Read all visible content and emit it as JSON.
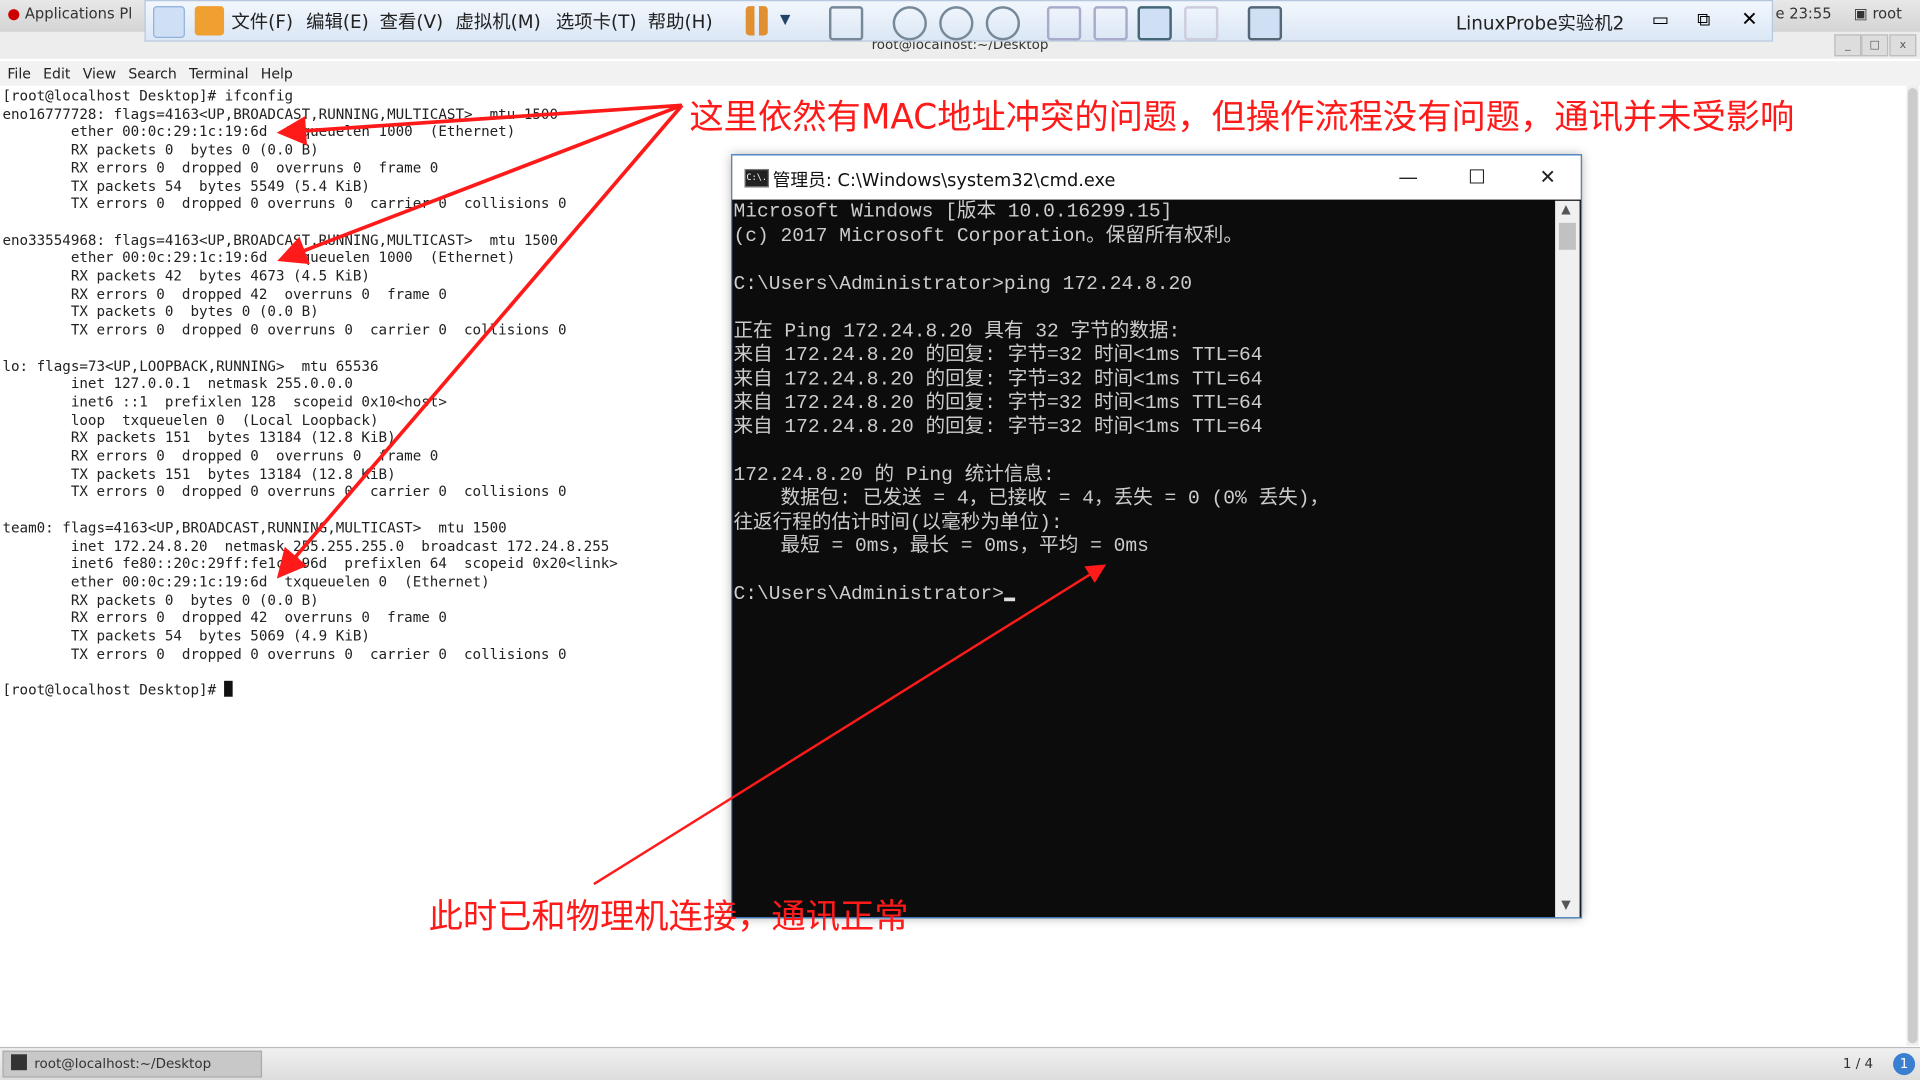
{
  "gnome_top": {
    "applications": "Applications",
    "places_partial": "Pl",
    "clock": "e 23:55",
    "user": "root"
  },
  "terminal_window": {
    "title": "root@localhost:~/Desktop",
    "menu": [
      "File",
      "Edit",
      "View",
      "Search",
      "Terminal",
      "Help"
    ],
    "lines": [
      "[root@localhost Desktop]# ifconfig",
      "eno16777728: flags=4163<UP,BROADCAST,RUNNING,MULTICAST>  mtu 1500",
      "        ether 00:0c:29:1c:19:6d  txqueuelen 1000  (Ethernet)",
      "        RX packets 0  bytes 0 (0.0 B)",
      "        RX errors 0  dropped 0  overruns 0  frame 0",
      "        TX packets 54  bytes 5549 (5.4 KiB)",
      "        TX errors 0  dropped 0 overruns 0  carrier 0  collisions 0",
      "",
      "eno33554968: flags=4163<UP,BROADCAST,RUNNING,MULTICAST>  mtu 1500",
      "        ether 00:0c:29:1c:19:6d  txqueuelen 1000  (Ethernet)",
      "        RX packets 42  bytes 4673 (4.5 KiB)",
      "        RX errors 0  dropped 42  overruns 0  frame 0",
      "        TX packets 0  bytes 0 (0.0 B)",
      "        TX errors 0  dropped 0 overruns 0  carrier 0  collisions 0",
      "",
      "lo: flags=73<UP,LOOPBACK,RUNNING>  mtu 65536",
      "        inet 127.0.0.1  netmask 255.0.0.0",
      "        inet6 ::1  prefixlen 128  scopeid 0x10<host>",
      "        loop  txqueuelen 0  (Local Loopback)",
      "        RX packets 151  bytes 13184 (12.8 KiB)",
      "        RX errors 0  dropped 0  overruns 0  frame 0",
      "        TX packets 151  bytes 13184 (12.8 KiB)",
      "        TX errors 0  dropped 0 overruns 0  carrier 0  collisions 0",
      "",
      "team0: flags=4163<UP,BROADCAST,RUNNING,MULTICAST>  mtu 1500",
      "        inet 172.24.8.20  netmask 255.255.255.0  broadcast 172.24.8.255",
      "        inet6 fe80::20c:29ff:fe1c:196d  prefixlen 64  scopeid 0x20<link>",
      "        ether 00:0c:29:1c:19:6d  txqueuelen 0  (Ethernet)",
      "        RX packets 0  bytes 0 (0.0 B)",
      "        RX errors 0  dropped 42  overruns 0  frame 0",
      "        TX packets 54  bytes 5069 (4.9 KiB)",
      "        TX errors 0  dropped 0 overruns 0  carrier 0  collisions 0",
      ""
    ],
    "prompt": "[root@localhost Desktop]# "
  },
  "vmware_bar": {
    "menus": [
      "文件(F)",
      "编辑(E)",
      "查看(V)",
      "虚拟机(M)",
      "选项卡(T)",
      "帮助(H)"
    ],
    "vm_name": "LinuxProbe实验机2"
  },
  "cmd_window": {
    "title": "管理员: C:\\Windows\\system32\\cmd.exe",
    "icon_text": "C:\\.",
    "lines": [
      "Microsoft Windows [版本 10.0.16299.15]",
      "(c) 2017 Microsoft Corporation。保留所有权利。",
      "",
      "C:\\Users\\Administrator>ping 172.24.8.20",
      "",
      "正在 Ping 172.24.8.20 具有 32 字节的数据:",
      "来自 172.24.8.20 的回复: 字节=32 时间<1ms TTL=64",
      "来自 172.24.8.20 的回复: 字节=32 时间<1ms TTL=64",
      "来自 172.24.8.20 的回复: 字节=32 时间<1ms TTL=64",
      "来自 172.24.8.20 的回复: 字节=32 时间<1ms TTL=64",
      "",
      "172.24.8.20 的 Ping 统计信息:",
      "    数据包: 已发送 = 4，已接收 = 4，丢失 = 0 (0% 丢失)，",
      "往返行程的估计时间(以毫秒为单位):",
      "    最短 = 0ms，最长 = 0ms，平均 = 0ms",
      ""
    ],
    "prompt": "C:\\Users\\Administrator>"
  },
  "annotations": {
    "top": "这里依然有MAC地址冲突的问题，但操作流程没有问题，通讯并未受影响",
    "bottom": "此时已和物理机连接，通讯正常",
    "color": "#ff1a1a"
  },
  "taskbar": {
    "item": "root@localhost:~/Desktop",
    "workspace": "1 / 4",
    "notification": "1"
  }
}
